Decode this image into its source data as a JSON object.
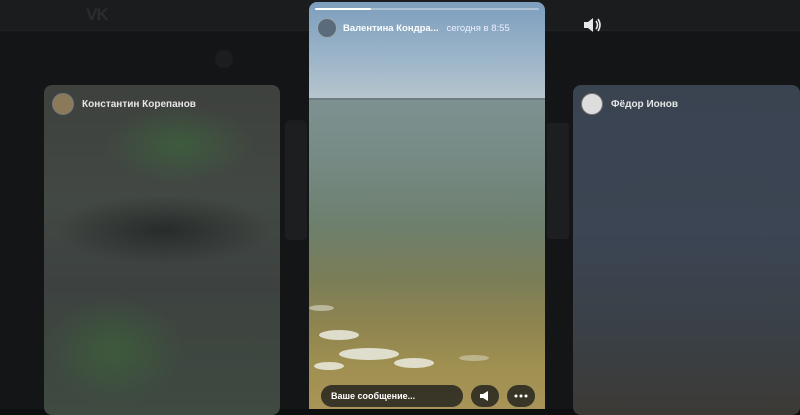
{
  "main_story": {
    "author": "Валентина Кондра...",
    "time": "сегодня в 8:55",
    "progress_fraction": 0.25,
    "reply_placeholder": "Ваше сообщение..."
  },
  "left_story": {
    "author": "Константин Корепанов"
  },
  "right_story": {
    "author": "Фёдор Ионов"
  },
  "icons": {
    "volume": "volume-icon",
    "megaphone": "megaphone-icon",
    "more": "more-icon"
  },
  "colors": {
    "overlay": "#0e0f10",
    "sky": "#9ab4c9",
    "sea": "#768a84"
  }
}
